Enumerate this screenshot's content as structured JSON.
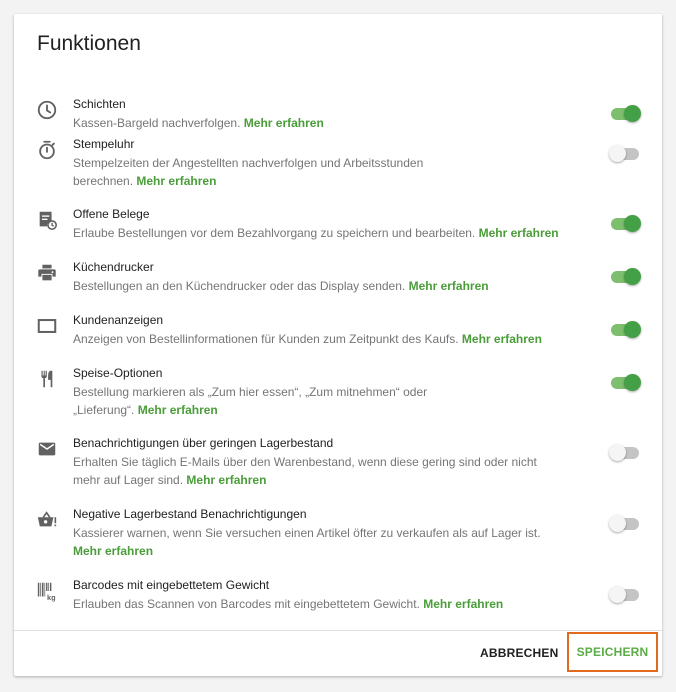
{
  "dialog": {
    "title": "Funktionen",
    "features": [
      {
        "icon": "clock-icon",
        "name": "Schichten",
        "description": "Kassen-Bargeld nachverfolgen.",
        "link": "Mehr erfahren",
        "enabled": true
      },
      {
        "icon": "stopwatch-icon",
        "name": "Stempeluhr",
        "description": "Stempelzeiten der Angestellten nachverfolgen und Arbeitsstunden berechnen.",
        "link": "Mehr erfahren",
        "enabled": false
      },
      {
        "icon": "receipt-clock-icon",
        "name": "Offene Belege",
        "description": "Erlaube Bestellungen vor dem Bezahlvorgang zu speichern und bearbeiten.",
        "link": "Mehr erfahren",
        "enabled": true
      },
      {
        "icon": "printer-icon",
        "name": "Küchendrucker",
        "description": "Bestellungen an den Küchendrucker oder das Display senden.",
        "link": "Mehr erfahren",
        "enabled": true
      },
      {
        "icon": "display-icon",
        "name": "Kundenanzeigen",
        "description": "Anzeigen von Bestellinformationen für Kunden zum Zeitpunkt des Kaufs.",
        "link": "Mehr erfahren",
        "enabled": true
      },
      {
        "icon": "fork-knife-icon",
        "name": "Speise-Optionen",
        "description": "Bestellung markieren als „Zum hier essen“, „Zum mitnehmen“ oder „Lieferung“.",
        "link": "Mehr erfahren",
        "enabled": true
      },
      {
        "icon": "envelope-icon",
        "name": "Benachrichtigungen über geringen Lagerbestand",
        "description": "Erhalten Sie täglich E-Mails über den Warenbestand, wenn diese gering sind oder nicht mehr auf Lager sind.",
        "link": "Mehr erfahren",
        "enabled": false
      },
      {
        "icon": "basket-alert-icon",
        "name": "Negative Lagerbestand Benachrichtigungen",
        "description": "Kassierer warnen, wenn Sie versuchen einen Artikel öfter zu verkaufen als auf Lager ist.",
        "link": "Mehr erfahren",
        "enabled": false
      },
      {
        "icon": "barcode-kg-icon",
        "name": "Barcodes mit eingebettetem Gewicht",
        "description": "Erlauben das Scannen von Barcodes mit eingebettetem Gewicht.",
        "link": "Mehr erfahren",
        "enabled": false
      }
    ],
    "actions": {
      "cancel_label": "ABBRECHEN",
      "save_label": "SPEICHERN"
    }
  },
  "colors": {
    "accent_green": "#5aac44",
    "link_green": "#4a9d39",
    "focus_orange": "#e26a1c",
    "toggle_on": "#43a047",
    "toggle_off": "#c4c4c4"
  }
}
